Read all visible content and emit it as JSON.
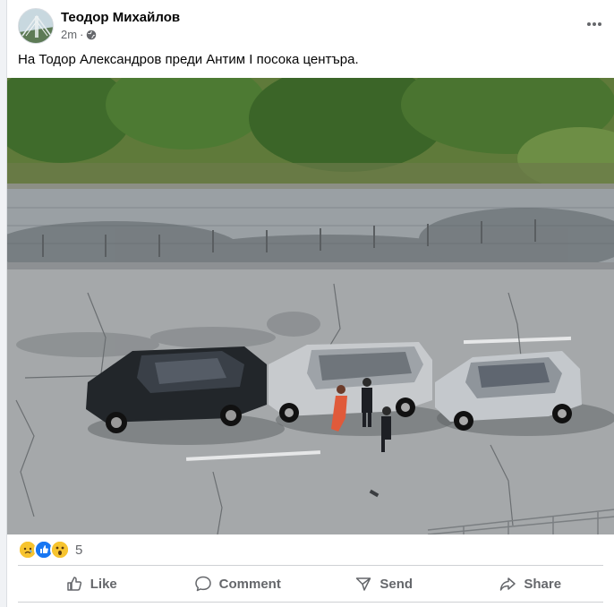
{
  "post": {
    "author": "Теодор Михайлов",
    "time": "2m",
    "separator": "·",
    "caption": "На Тодор Александров преди Антим I посока центъра.",
    "privacy_icon": "globe-icon",
    "menu_icon": "more-horizontal-icon"
  },
  "reactions": {
    "icons": [
      "sad-reaction-icon",
      "like-reaction-icon",
      "wow-reaction-icon"
    ],
    "count": "5"
  },
  "actions": {
    "like_label": "Like",
    "comment_label": "Comment",
    "send_label": "Send",
    "share_label": "Share"
  },
  "colors": {
    "accent": "#0866ff",
    "secondary_text": "#65676b",
    "divider": "#ced0d4"
  }
}
